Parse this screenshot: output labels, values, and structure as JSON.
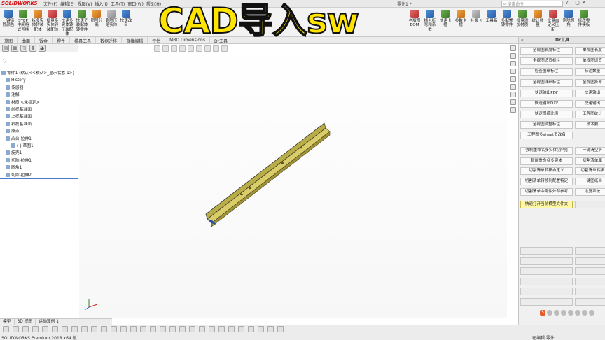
{
  "app": {
    "logo": "SOLIDWORKS",
    "menu": [
      "文件(F)",
      "编辑(E)",
      "视图(V)",
      "插入(I)",
      "工具(T)",
      "窗口(W)",
      "帮助(H)"
    ],
    "doc_title": "零件1 *",
    "search_placeholder": "搜索命令"
  },
  "banner": {
    "text": "CAD导入sw"
  },
  "ribbon": {
    "left_buttons": [
      {
        "label": "一键清除颜色",
        "icon": "palette-icon"
      },
      {
        "label": "STEP中间格式互换",
        "icon": "step-convert-icon"
      },
      {
        "label": "拆多实体转装配体",
        "icon": "split-body-icon"
      },
      {
        "label": "批量多实体转装配体",
        "icon": "batch-body-icon"
      },
      {
        "label": "快速多实体转子装配体",
        "icon": "sub-assembly-icon"
      },
      {
        "label": "快速子装配体转零件",
        "icon": "assembly-to-part-icon"
      },
      {
        "label": "图号分离",
        "icon": "number-split-icon"
      },
      {
        "label": "删除压缩实体",
        "icon": "delete-body-icon"
      },
      {
        "label": "快速改名",
        "icon": "rename-icon"
      }
    ],
    "right_buttons": [
      {
        "label": "老版图BOM",
        "icon": "bom-icon"
      },
      {
        "label": "插入折弯和系数",
        "icon": "bend-icon"
      },
      {
        "label": "快速卡槽",
        "icon": "slot-icon"
      },
      {
        "label": "参数卡槽",
        "icon": "param-slot-icon"
      },
      {
        "label": "补偿卡",
        "icon": "offset-icon"
      },
      {
        "label": "工具箱",
        "icon": "toolbox-icon"
      },
      {
        "label": "多配置转零件",
        "icon": "config-icon"
      },
      {
        "label": "批量添加材质",
        "icon": "material-icon"
      },
      {
        "label": "统计数量",
        "icon": "count-icon"
      },
      {
        "label": "批量自定义压配",
        "icon": "custom-icon"
      },
      {
        "label": "删除圆角",
        "icon": "fillet-delete-icon"
      },
      {
        "label": "修改零件模板",
        "icon": "template-icon"
      }
    ]
  },
  "tabs": [
    "草图",
    "曲面",
    "钣金",
    "焊件",
    "模具工具",
    "数据迁移",
    "直接编辑",
    "评估",
    "MBD Dimensions",
    "Dr工具"
  ],
  "left_panel": {
    "tree": [
      {
        "label": "零件1 (默认<<默认>_显示状态 1>)",
        "indent": 0
      },
      {
        "label": "History",
        "indent": 6
      },
      {
        "label": "传感器",
        "indent": 6
      },
      {
        "label": "注解",
        "indent": 6
      },
      {
        "label": "材质 <未指定>",
        "indent": 6
      },
      {
        "label": "前视基准面",
        "indent": 6
      },
      {
        "label": "上视基准面",
        "indent": 6
      },
      {
        "label": "右视基准面",
        "indent": 6
      },
      {
        "label": "原点",
        "indent": 6
      },
      {
        "label": "凸台-拉伸1",
        "indent": 6
      },
      {
        "label": "(-) 草图1",
        "indent": 14
      },
      {
        "label": "旋壳1",
        "indent": 6
      },
      {
        "label": "切除-拉伸1",
        "indent": 6
      },
      {
        "label": "圆角1",
        "indent": 6
      },
      {
        "label": "切除-拉伸2",
        "indent": 6
      }
    ],
    "bottom_tabs": [
      "模型",
      "3D 视图",
      "运动算例 1"
    ]
  },
  "right_panel": {
    "title": "Dr工具",
    "buttons_pairs": [
      [
        "全视图长度标注",
        "单视图长度"
      ],
      [
        "全视图适宜标注",
        "单视图适宜"
      ],
      [
        "检查图纸标注",
        "标注数量"
      ],
      [
        "全视图详细标注",
        "全视图折弯"
      ],
      [
        "快速输出PDF",
        "快速输出"
      ],
      [
        "快速输出DXF",
        "快速输出"
      ],
      [
        "快速图纸比例",
        "工程图统计"
      ],
      [
        "全视图调整标注",
        "技术要"
      ]
    ],
    "single_button": "工程图多sheet页改名",
    "buttons_pairs2": [
      [
        "强制重命名多实体[序号]",
        "一键清空折"
      ],
      [
        "智能重命名多实体",
        "切割清单属"
      ],
      [
        "切割清单转移自定义",
        "切割清单转移"
      ],
      [
        "切割清单转移到配置特定",
        "一键图纸自"
      ],
      [
        "切割清单中零件外部参考",
        "恢复系统"
      ]
    ],
    "highlight_button": "快速打开当前模型文件夹"
  },
  "status": {
    "left": "SOLIDWORKS Premium 2018 x64 版",
    "right": "在编辑  零件"
  }
}
